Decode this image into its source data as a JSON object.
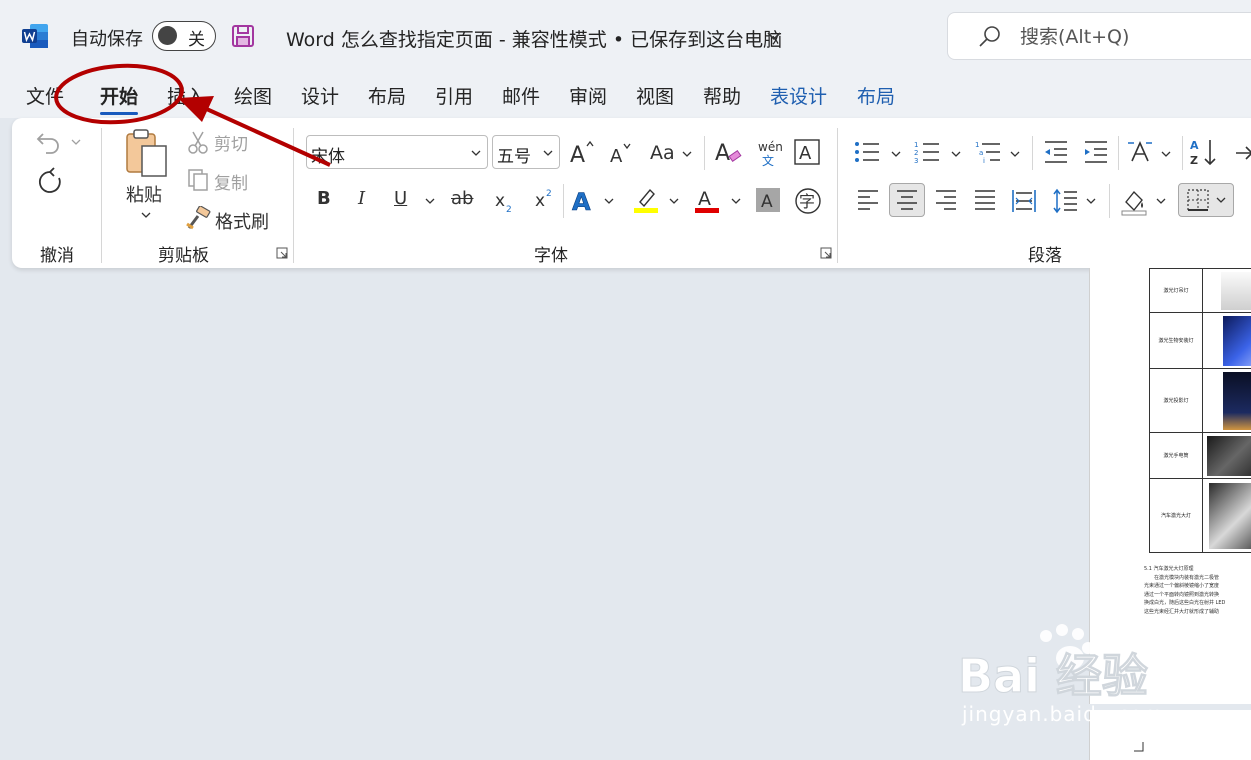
{
  "titlebar": {
    "autosave_label": "自动保存",
    "autosave_state": "关",
    "doc_title": "Word 怎么查找指定页面  -  兼容性模式 • 已保存到这台电脑",
    "search_placeholder": "搜索(Alt+Q)"
  },
  "tabs": [
    "文件",
    "开始",
    "插入",
    "绘图",
    "设计",
    "布局",
    "引用",
    "邮件",
    "审阅",
    "视图",
    "帮助",
    "表设计",
    "布局"
  ],
  "active_tab": "开始",
  "ribbon": {
    "undo_group": "撤消",
    "clipboard": {
      "paste": "粘贴",
      "cut": "剪切",
      "copy": "复制",
      "format_painter": "格式刷",
      "group": "剪贴板"
    },
    "font": {
      "font_name": "宋体",
      "font_size": "五号",
      "group": "字体",
      "case_label": "Aa",
      "phonetic_label": "wén",
      "phonetic_char": "文"
    },
    "paragraph": {
      "group": "段落"
    }
  },
  "document": {
    "table_rows": [
      "激光灯吊灯",
      "激光生物安装灯",
      "激光投影灯",
      "激光手电筒",
      "汽车激光大灯"
    ],
    "section_heading": "5.1 汽车激光大灯原理",
    "body_lines": [
      "在激光模块内装有激光二极管",
      "光束通过一个偏斜棱镜缩小了宽度",
      "通过一个平面转向镜照到激光转换",
      "换成白光，随后这些白光在射并 LED",
      "这些光束经汇并大灯就形成了辅助"
    ]
  },
  "watermark": {
    "brand": "Bai 经验",
    "url": "jingyan.baidu.com"
  },
  "colors": {
    "accent": "#185abd",
    "annotation": "#b30000",
    "highlight": "#ffff00",
    "font_color": "#e00000"
  }
}
